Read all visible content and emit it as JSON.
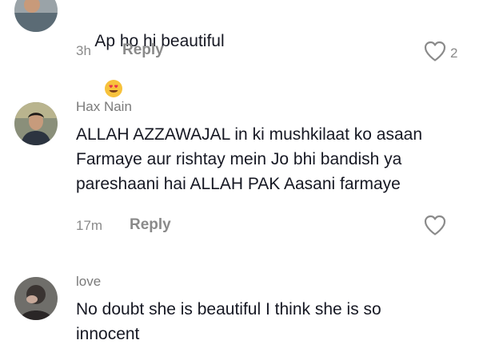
{
  "comments": [
    {
      "text": "Ap ho hi beautiful",
      "emoji": "😍",
      "time": "3h",
      "reply_label": "Reply",
      "likes": "2"
    },
    {
      "username": "Hax Nain",
      "text": "ALLAH AZZAWAJAL in ki mushkilaat ko asaan\nFarmaye aur rishtay mein Jo bhi bandish ya\npareshaani hai ALLAH PAK Aasani farmaye",
      "time": "17m",
      "reply_label": "Reply"
    },
    {
      "username": "love",
      "text": "No doubt she is beautiful I think she is so\ninnocent"
    }
  ],
  "icons": {
    "like": "heart-outline-icon",
    "emoji": "smiling-face-with-heart-eyes"
  },
  "colors": {
    "text": "#161823",
    "secondary": "#8a8a8a",
    "background": "#ffffff"
  }
}
